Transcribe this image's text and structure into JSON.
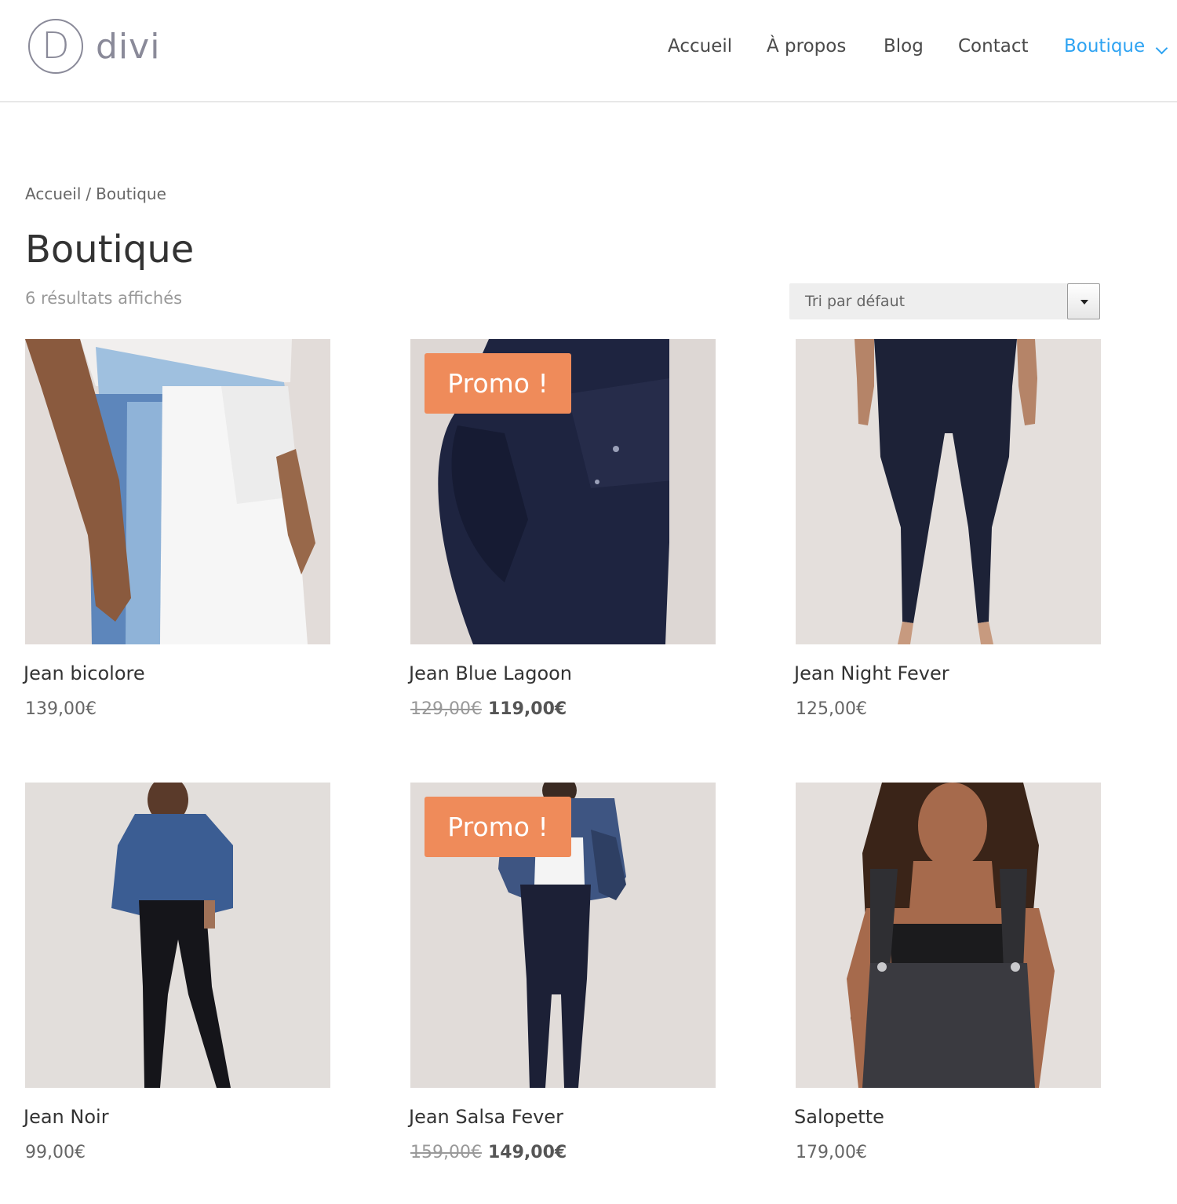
{
  "header": {
    "logo": {
      "mark": "D",
      "wordmark": "divi"
    },
    "nav": [
      {
        "label": "Accueil"
      },
      {
        "label": "À propos"
      },
      {
        "label": "Blog"
      },
      {
        "label": "Contact"
      },
      {
        "label": "Boutique",
        "active": true,
        "has_dropdown": true
      }
    ]
  },
  "breadcrumb": {
    "home": "Accueil",
    "separator": "/",
    "current": "Boutique"
  },
  "page": {
    "title": "Boutique",
    "result_count": "6 résultats affichés",
    "sort_select": {
      "selected": "Tri par défaut"
    }
  },
  "products": [
    {
      "title": "Jean bicolore",
      "price": "139,00€",
      "promo": false,
      "image": "model wearing two-tone blue and white jeans"
    },
    {
      "title": "Jean Blue Lagoon",
      "price_old": "129,00€",
      "price": "119,00€",
      "promo": true,
      "promo_label": "Promo !",
      "image": "close-up of dark navy jeans back pocket"
    },
    {
      "title": "Jean Night Fever",
      "price": "125,00€",
      "promo": false,
      "image": "legs in dark navy skinny jeans"
    },
    {
      "title": "Jean Noir",
      "price": "99,00€",
      "promo": false,
      "image": "model in denim shirt and black jeans"
    },
    {
      "title": "Jean Salsa Fever",
      "price_old": "159,00€",
      "price": "149,00€",
      "promo": true,
      "promo_label": "Promo !",
      "image": "model in denim jacket and navy jeans"
    },
    {
      "title": "Salopette",
      "price": "179,00€",
      "promo": false,
      "image": "model wearing black denim overalls"
    }
  ],
  "colors": {
    "accent": "#2ea3f2",
    "promo_badge": "#ef8b5a",
    "heading": "#333333",
    "text": "#666666",
    "muted": "#999999",
    "photo_background": "#e4dfdc"
  }
}
